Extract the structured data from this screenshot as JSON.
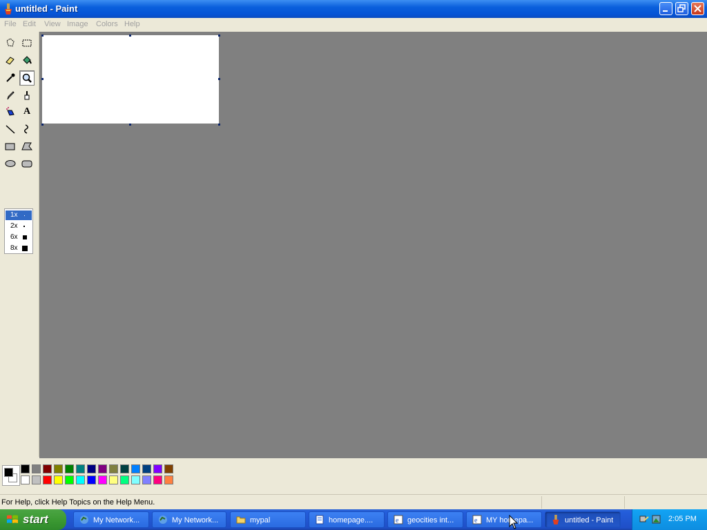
{
  "window": {
    "title": "untitled - Paint"
  },
  "menu": [
    "File",
    "Edit",
    "View",
    "Image",
    "Colors",
    "Help"
  ],
  "tools": [
    {
      "name": "free-form-select-icon"
    },
    {
      "name": "select-icon"
    },
    {
      "name": "eraser-icon"
    },
    {
      "name": "fill-with-color-icon"
    },
    {
      "name": "pick-color-icon"
    },
    {
      "name": "magnifier-icon",
      "active": true
    },
    {
      "name": "pencil-icon"
    },
    {
      "name": "brush-icon"
    },
    {
      "name": "airbrush-icon"
    },
    {
      "name": "text-icon",
      "glyph": "A"
    },
    {
      "name": "line-icon"
    },
    {
      "name": "curve-icon"
    },
    {
      "name": "rectangle-icon"
    },
    {
      "name": "polygon-icon"
    },
    {
      "name": "ellipse-icon"
    },
    {
      "name": "rounded-rectangle-icon"
    }
  ],
  "zoom_options": [
    {
      "label": "1x",
      "selected": true
    },
    {
      "label": "2x"
    },
    {
      "label": "6x"
    },
    {
      "label": "8x"
    }
  ],
  "colors": {
    "foreground": "#000000",
    "background": "#ffffff"
  },
  "palette_top": [
    "#000000",
    "#808080",
    "#800000",
    "#808000",
    "#008000",
    "#008080",
    "#000080",
    "#800080",
    "#808040",
    "#004040",
    "#0080ff",
    "#004080",
    "#8000ff",
    "#804000"
  ],
  "palette_bottom": [
    "#ffffff",
    "#c0c0c0",
    "#ff0000",
    "#ffff00",
    "#00ff00",
    "#00ffff",
    "#0000ff",
    "#ff00ff",
    "#ffff80",
    "#00ff80",
    "#80ffff",
    "#8080ff",
    "#ff0080",
    "#ff8040"
  ],
  "status": {
    "message": "For Help, click Help Topics on the Help Menu."
  },
  "taskbar": {
    "start_label": "start",
    "tasks": [
      {
        "label": "My Network...",
        "icon": "network-icon"
      },
      {
        "label": "My Network...",
        "icon": "network-icon"
      },
      {
        "label": "mypal",
        "icon": "folder-icon"
      },
      {
        "label": "homepage....",
        "icon": "document-icon"
      },
      {
        "label": "geocities int...",
        "icon": "browser-icon"
      },
      {
        "label": "MY homepa...",
        "icon": "browser-icon"
      },
      {
        "label": "untitled - Paint",
        "icon": "paint-icon",
        "active": true
      }
    ],
    "clock": "2:05 PM"
  }
}
